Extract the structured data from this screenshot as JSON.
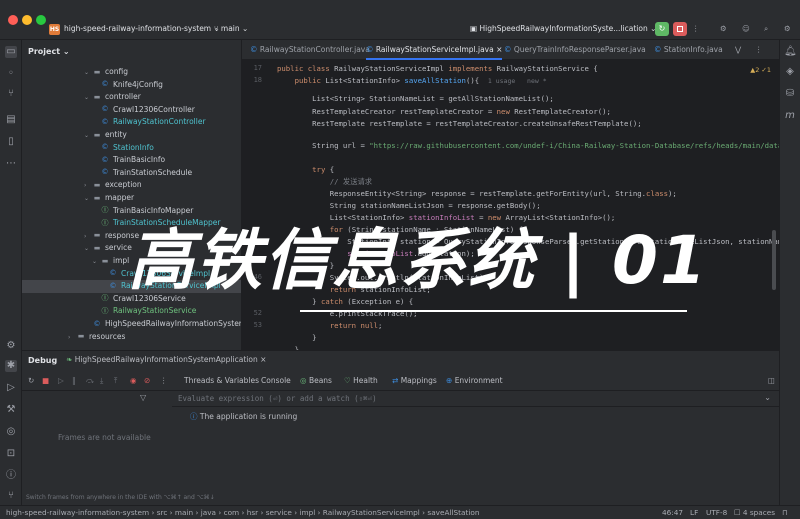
{
  "titlebar": {
    "project_badge": "HS",
    "project_name": "high-speed-railway-information-system",
    "branch": "main",
    "run_config": "HighSpeedRailwayInformationSyste...lication"
  },
  "project_panel": {
    "title": "Project",
    "tree": [
      {
        "label": "config",
        "kind": "folder",
        "expanded": true
      },
      {
        "label": "Knife4jConfig",
        "kind": "class",
        "color": "white"
      },
      {
        "label": "controller",
        "kind": "folder",
        "expanded": true
      },
      {
        "label": "Crawl12306Controller",
        "kind": "class",
        "color": "white"
      },
      {
        "label": "RailwayStationController",
        "kind": "class",
        "color": "cyan"
      },
      {
        "label": "entity",
        "kind": "folder",
        "expanded": true
      },
      {
        "label": "StationInfo",
        "kind": "class",
        "color": "cyan"
      },
      {
        "label": "TrainBasicInfo",
        "kind": "class",
        "color": "white"
      },
      {
        "label": "TrainStationSchedule",
        "kind": "class",
        "color": "white"
      },
      {
        "label": "exception",
        "kind": "folder",
        "expanded": false
      },
      {
        "label": "mapper",
        "kind": "folder",
        "expanded": true
      },
      {
        "label": "TrainBasicInfoMapper",
        "kind": "interface",
        "color": "white"
      },
      {
        "label": "TrainStationScheduleMapper",
        "kind": "interface",
        "color": "cyan"
      },
      {
        "label": "response",
        "kind": "folder",
        "expanded": false
      },
      {
        "label": "service",
        "kind": "folder",
        "expanded": true
      },
      {
        "label": "impl",
        "kind": "folder",
        "expanded": true
      },
      {
        "label": "Crawl12306ServiceImpl",
        "kind": "class",
        "color": "cyan"
      },
      {
        "label": "RailwayStationServiceImpl",
        "kind": "class",
        "color": "cyan"
      },
      {
        "label": "Crawl12306Service",
        "kind": "interface",
        "color": "white"
      },
      {
        "label": "RailwayStationService",
        "kind": "interface",
        "color": "green"
      },
      {
        "label": "HighSpeedRailwayInformationSystemApplication",
        "kind": "class",
        "color": "white"
      },
      {
        "label": "resources",
        "kind": "folder",
        "expanded": false
      }
    ]
  },
  "editor": {
    "tabs": [
      {
        "label": "RailwayStationController.java",
        "active": false
      },
      {
        "label": "RailwayStationServiceImpl.java",
        "active": true
      },
      {
        "label": "QueryTrainInfoResponseParser.java",
        "active": false
      },
      {
        "label": "StationInfo.java",
        "active": false
      }
    ],
    "inspection": "▲2  ✓1",
    "line_numbers": [
      "17",
      "18",
      "",
      "",
      "",
      "",
      "",
      "",
      "",
      "",
      "",
      "",
      "",
      "",
      "",
      "",
      "",
      "",
      "46",
      "",
      "",
      "52",
      "53",
      ""
    ],
    "usage_hint": "1 usage   new *"
  },
  "overlay": {
    "banner": "高铁信息系统 | 01"
  },
  "debug_panel": {
    "title": "Debug",
    "session": "HighSpeedRailwayInformationSystemApplication",
    "tabs": [
      "Threads & Variables",
      "Console",
      "Beans",
      "Health",
      "Mappings",
      "Environment"
    ],
    "eval_placeholder": "Evaluate expression (⏎) or add a watch (⇧⌘⏎)",
    "frames_empty": "Frames are not available",
    "status_message": "The application is running",
    "frames_hint": "Switch frames from anywhere in the IDE with ⌥⌘↑ and ⌥⌘↓"
  },
  "statusbar": {
    "breadcrumb": [
      "high-speed-railway-information-system",
      "src",
      "main",
      "java",
      "com",
      "hsr",
      "service",
      "impl",
      "RailwayStationServiceImpl",
      "saveAllStation"
    ],
    "position": "46:47",
    "line_sep": "LF",
    "encoding": "UTF-8",
    "indent": "4 spaces"
  },
  "colors": {
    "accent": "#3574f0",
    "run_green": "#5fb865",
    "stop_red": "#db5c5c"
  }
}
